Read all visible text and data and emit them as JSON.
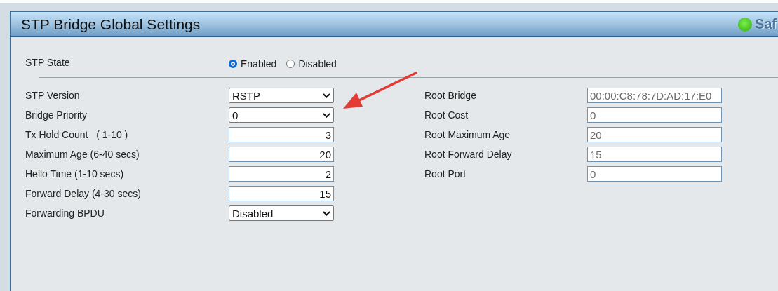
{
  "panel": {
    "title": "STP Bridge Global Settings",
    "status_text": "Saf"
  },
  "stp_state": {
    "label": "STP State",
    "options": [
      {
        "label": "Enabled",
        "selected": true
      },
      {
        "label": "Disabled",
        "selected": false
      }
    ]
  },
  "settings": [
    {
      "label": "STP Version",
      "kind": "select",
      "value": "RSTP"
    },
    {
      "label": "Bridge Priority",
      "kind": "select",
      "value": "0"
    },
    {
      "label": "Tx Hold Count   ( 1-10 )",
      "kind": "number",
      "value": "3"
    },
    {
      "label": "Maximum Age (6-40 secs)",
      "kind": "number",
      "value": "20"
    },
    {
      "label": "Hello Time (1-10 secs)",
      "kind": "number",
      "value": "2"
    },
    {
      "label": "Forward Delay (4-30 secs)",
      "kind": "number",
      "value": "15"
    },
    {
      "label": "Forwarding BPDU",
      "kind": "select",
      "value": "Disabled"
    }
  ],
  "root_info": [
    {
      "label": "Root Bridge",
      "value": "00:00:C8:78:7D:AD:17:E0"
    },
    {
      "label": "Root Cost",
      "value": "0"
    },
    {
      "label": "Root Maximum Age",
      "value": "20"
    },
    {
      "label": "Root Forward Delay",
      "value": "15"
    },
    {
      "label": "Root Port",
      "value": "0"
    }
  ]
}
